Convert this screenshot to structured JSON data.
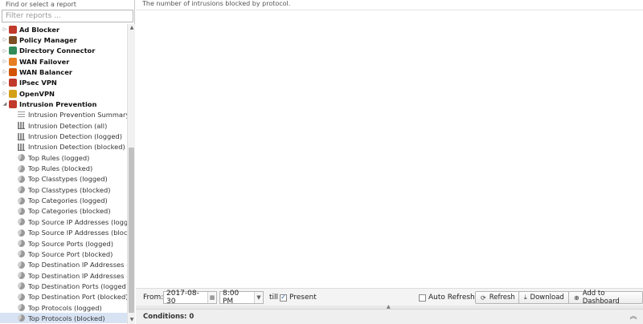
{
  "sidebar": {
    "find_label": "Find or select a report",
    "filter_placeholder": "Filter reports ...",
    "apps": [
      {
        "label": "Ad Blocker",
        "color": "#c0392b",
        "icon": "ad-blocker-icon"
      },
      {
        "label": "Policy Manager",
        "color": "#7d4e24",
        "icon": "policy-manager-icon"
      },
      {
        "label": "Directory Connector",
        "color": "#2e8b57",
        "icon": "directory-connector-icon"
      },
      {
        "label": "WAN Failover",
        "color": "#e67e22",
        "icon": "wan-failover-icon"
      },
      {
        "label": "WAN Balancer",
        "color": "#d35400",
        "icon": "wan-balancer-icon"
      },
      {
        "label": "IPsec VPN",
        "color": "#c0392b",
        "icon": "ipsec-vpn-icon"
      },
      {
        "label": "OpenVPN",
        "color": "#d4a017",
        "icon": "openvpn-icon"
      },
      {
        "label": "Intrusion Prevention",
        "color": "#c0392b",
        "icon": "intrusion-prevention-icon"
      }
    ],
    "reports": [
      {
        "label": "Intrusion Prevention Summary",
        "icon": "text"
      },
      {
        "label": "Intrusion Detection (all)",
        "icon": "bars"
      },
      {
        "label": "Intrusion Detection (logged)",
        "icon": "bars"
      },
      {
        "label": "Intrusion Detection (blocked)",
        "icon": "bars"
      },
      {
        "label": "Top Rules (logged)",
        "icon": "pie"
      },
      {
        "label": "Top Rules (blocked)",
        "icon": "pie"
      },
      {
        "label": "Top Classtypes (logged)",
        "icon": "pie"
      },
      {
        "label": "Top Classtypes (blocked)",
        "icon": "pie"
      },
      {
        "label": "Top Categories (logged)",
        "icon": "pie"
      },
      {
        "label": "Top Categories (blocked)",
        "icon": "pie"
      },
      {
        "label": "Top Source IP Addresses (logged)",
        "icon": "pie"
      },
      {
        "label": "Top Source IP Addresses (blocked)",
        "icon": "pie"
      },
      {
        "label": "Top Source Ports (logged)",
        "icon": "pie"
      },
      {
        "label": "Top Source Port (blocked)",
        "icon": "pie"
      },
      {
        "label": "Top Destination IP Addresses (lo...",
        "icon": "pie"
      },
      {
        "label": "Top Destination IP Addresses (blo...",
        "icon": "pie"
      },
      {
        "label": "Top Destination Ports (logged)",
        "icon": "pie"
      },
      {
        "label": "Top Destination Port (blocked)",
        "icon": "pie"
      },
      {
        "label": "Top Protocols (logged)",
        "icon": "pie"
      },
      {
        "label": "Top Protocols (blocked)",
        "icon": "pie"
      }
    ],
    "selected_report": "Top Protocols (blocked)"
  },
  "main": {
    "description": "The number of intrusions blocked by protocol."
  },
  "toolbar": {
    "from_label": "From:",
    "date": "2017-08-30",
    "time": "8:00 PM",
    "till_label": "till",
    "present_label": "Present",
    "present_checked": true,
    "auto_refresh_label": "Auto Refresh",
    "auto_refresh_checked": false,
    "refresh_label": "Refresh",
    "download_label": "Download",
    "add_dashboard_label": "Add to Dashboard"
  },
  "conditions": {
    "label": "Conditions: 0"
  }
}
